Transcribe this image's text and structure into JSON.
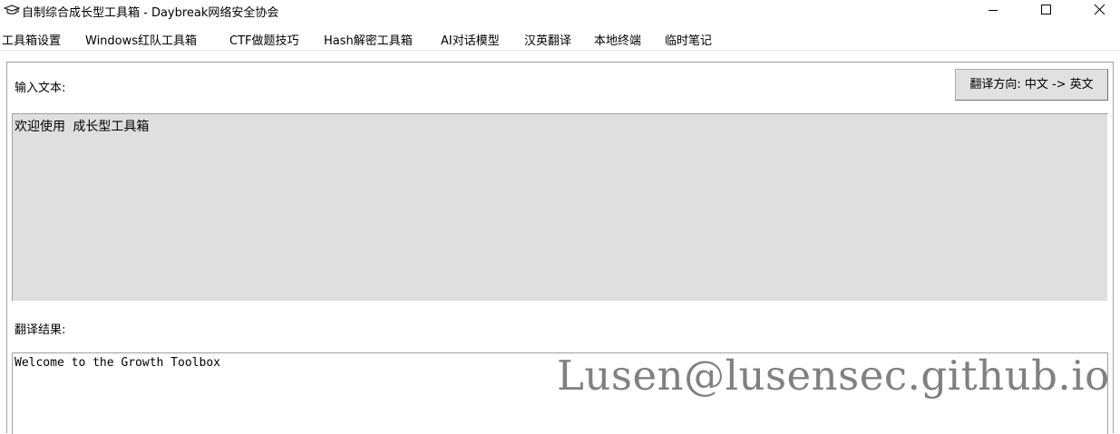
{
  "window": {
    "title": "自制综合成长型工具箱 - Daybreak网络安全协会",
    "app_icon": "graduation-cap-icon",
    "controls": [
      "minimize-icon",
      "maximize-icon",
      "close-icon"
    ]
  },
  "menu": {
    "items": [
      "工具箱设置",
      "Windows红队工具箱",
      "CTF做题技巧",
      "Hash解密工具箱",
      "AI对话模型",
      "汉英翻译",
      "本地终端",
      "临时笔记"
    ]
  },
  "translator": {
    "input_label": "输入文本:",
    "direction_button": "翻译方向: 中文 -> 英文",
    "input_value": "欢迎使用 成长型工具箱",
    "result_label": "翻译结果:",
    "result_value": "Welcome to the Growth Toolbox"
  },
  "watermark": "Lusen@lusensec.github.io",
  "colors": {
    "input_bg": "#dfdfdf",
    "button_bg": "#e1e1e1",
    "border": "#a0a0a0"
  }
}
